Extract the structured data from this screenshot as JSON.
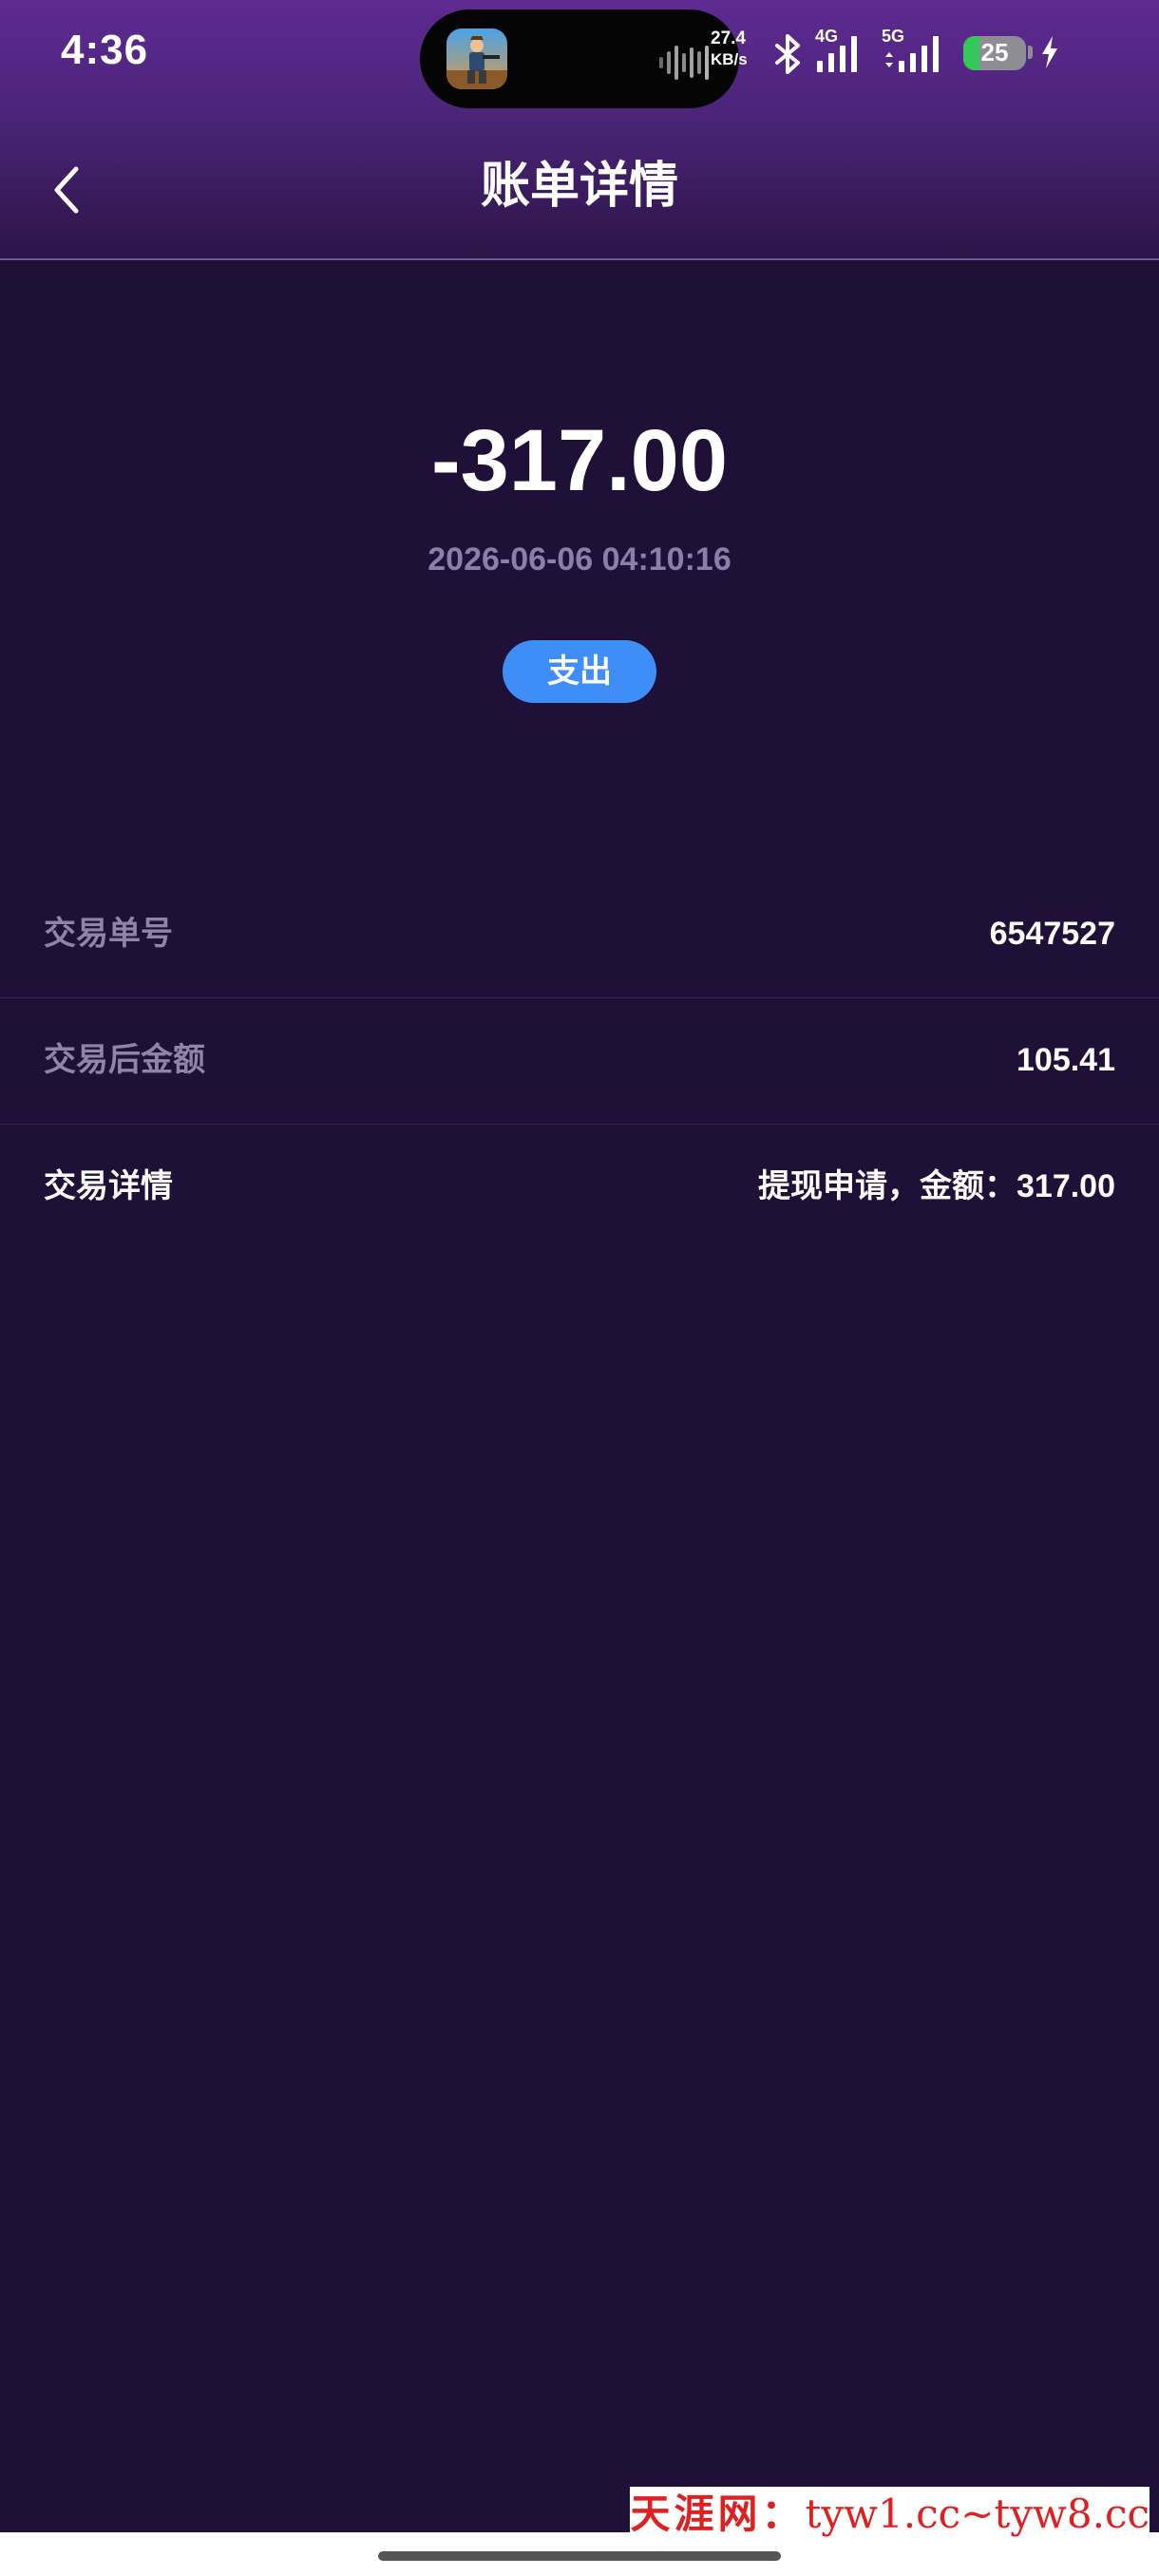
{
  "status_bar": {
    "time": "4:36",
    "net_speed_value": "27.4",
    "net_speed_unit": "KB/s",
    "signal_1_label": "4G",
    "signal_2_label": "5G",
    "battery_level": "25",
    "battery_fraction": 0.25,
    "icons": [
      "game-app-icon",
      "audio-wave-icon",
      "bluetooth-icon",
      "signal-4g-icon",
      "signal-5g-icon",
      "battery-icon",
      "charging-bolt-icon"
    ]
  },
  "header": {
    "title": "账单详情",
    "back_icon": "chevron-left-icon"
  },
  "transaction": {
    "amount": "-317.00",
    "datetime": "2026-06-06 04:10:16",
    "type": "支出"
  },
  "details": [
    {
      "label": "交易单号",
      "value": "6547527"
    },
    {
      "label": "交易后金额",
      "value": "105.41"
    },
    {
      "label": "交易详情",
      "value": "提现申请，金额：317.00"
    }
  ],
  "watermark": {
    "site_name": "天涯网：",
    "site_url": "tyw1.cc~tyw8.cc"
  },
  "colors": {
    "background": "#1f1038",
    "header_gradient_top": "#5e2a92",
    "pill_blue": "#3f8ef7",
    "muted_text": "#8a7fa6",
    "watermark_red": "#e02020"
  }
}
